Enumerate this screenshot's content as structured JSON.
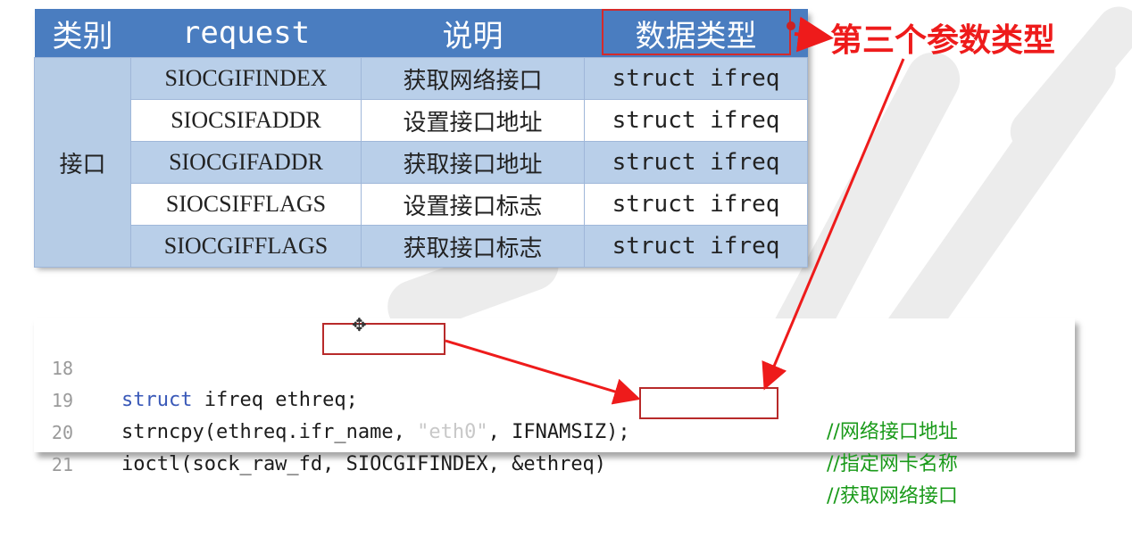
{
  "table": {
    "headers": {
      "category": "类别",
      "request": "request",
      "description": "说明",
      "data_type": "数据类型"
    },
    "category_label": "接口",
    "rows": [
      {
        "request": "SIOCGIFINDEX",
        "description": "获取网络接口",
        "data_type": "struct ifreq"
      },
      {
        "request": "SIOCSIFADDR",
        "description": "设置接口地址",
        "data_type": "struct ifreq"
      },
      {
        "request": "SIOCGIFADDR",
        "description": "获取接口地址",
        "data_type": "struct ifreq"
      },
      {
        "request": "SIOCSIFFLAGS",
        "description": "设置接口标志",
        "data_type": "struct ifreq"
      },
      {
        "request": "SIOCGIFFLAGS",
        "description": "获取接口标志",
        "data_type": "struct ifreq"
      }
    ],
    "header_color": "#4a7dc0",
    "row_color": "#b9cfe9"
  },
  "annotation": {
    "text": "第三个参数类型",
    "color": "#ee1b1b"
  },
  "code": {
    "lines": [
      {
        "num": "18",
        "kw": "struct",
        "rest": " ifreq ethreq;",
        "comment": "//网络接口地址"
      },
      {
        "num": "19",
        "pre": "strncpy(ethreq.ifr_name, ",
        "str": "\"eth0\"",
        "post": ", IFNAMSIZ);",
        "comment": "//指定网卡名称"
      },
      {
        "num": "20",
        "text": "ioctl(sock_raw_fd, SIOCGIFINDEX, &ethreq)",
        "comment": "//获取网络接口"
      },
      {
        "num": "21",
        "text": "",
        "comment": ""
      }
    ],
    "comment_color": "#1a9a1a",
    "keyword_color": "#3a59b8"
  }
}
